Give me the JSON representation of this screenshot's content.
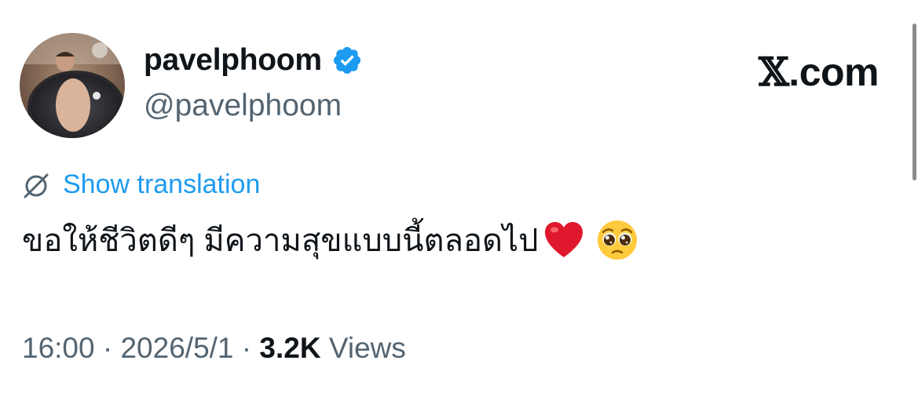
{
  "author": {
    "display_name": "pavelphoom",
    "handle": "@pavelphoom",
    "verified": true,
    "verified_color": "#1d9bf0",
    "avatar_icon": "profile-photo"
  },
  "brand": {
    "label": ".com",
    "glyph": "𝕏"
  },
  "translation": {
    "label": "Show translation",
    "icon": "globe-slash-icon",
    "color": "#1d9bf0"
  },
  "tweet": {
    "text": "ขอให้ชีวิตดีๆ มีความสุขแบบนี้ตลอดไป",
    "emojis": [
      "red-heart",
      "pleading-face"
    ]
  },
  "meta": {
    "time": "16:00",
    "separator": "·",
    "date": "2026/5/1",
    "views_count": "3.2K",
    "views_label": "Views"
  },
  "colors": {
    "text_primary": "#0f1419",
    "text_secondary": "#536471",
    "accent": "#1d9bf0"
  }
}
